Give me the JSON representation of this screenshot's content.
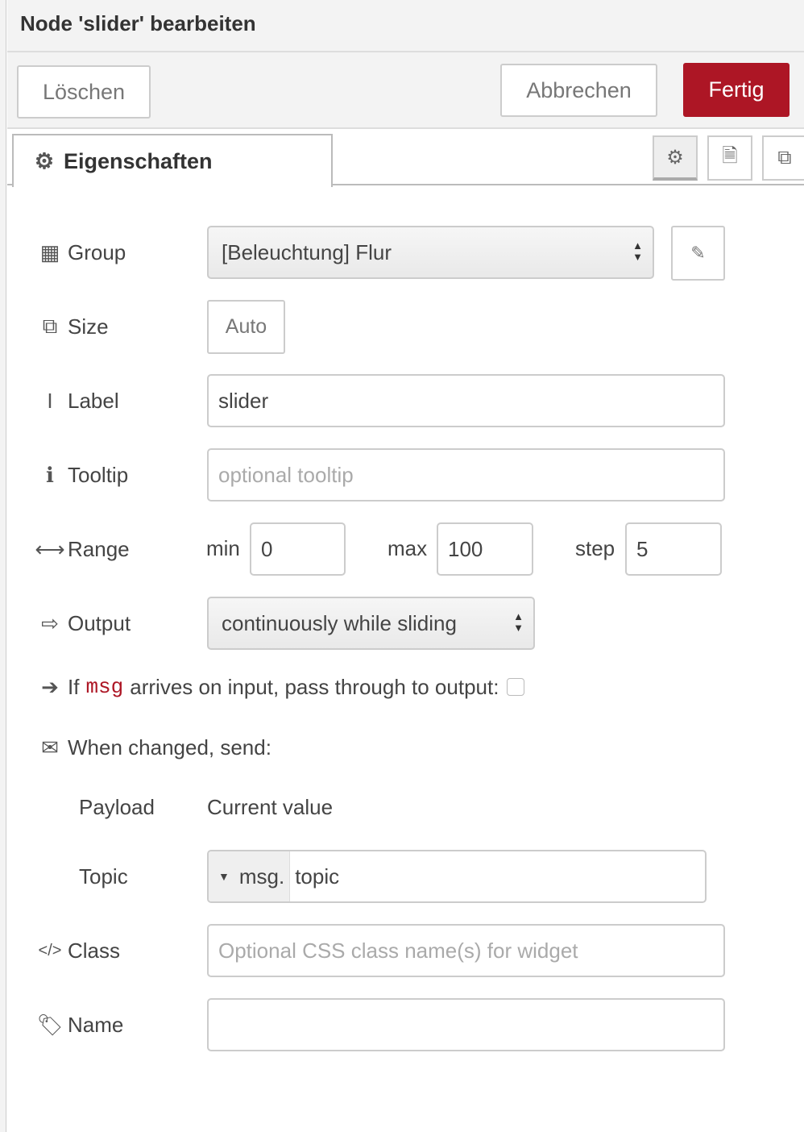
{
  "title": "Node 'slider' bearbeiten",
  "toolbar": {
    "delete": "Löschen",
    "cancel": "Abbrechen",
    "done": "Fertig",
    "accent": "#ad1625"
  },
  "tabs": {
    "properties": "Eigenschaften",
    "icons": [
      "gear-icon",
      "description-icon",
      "appearance-icon"
    ]
  },
  "form": {
    "group": {
      "label": "Group",
      "value": "[Beleuchtung] Flur"
    },
    "size": {
      "label": "Size",
      "value": "Auto"
    },
    "label": {
      "label": "Label",
      "value": "slider"
    },
    "tooltip": {
      "label": "Tooltip",
      "placeholder": "optional tooltip"
    },
    "range": {
      "label": "Range",
      "min_label": "min",
      "min": "0",
      "max_label": "max",
      "max": "100",
      "step_label": "step",
      "step": "5"
    },
    "output": {
      "label": "Output",
      "value": "continuously while sliding"
    },
    "passthrough": {
      "prefix": "If",
      "code": "msg",
      "suffix": "arrives on input, pass through to output:",
      "checked": false
    },
    "send": {
      "label": "When changed, send:"
    },
    "payload": {
      "label": "Payload",
      "value": "Current value"
    },
    "topic": {
      "label": "Topic",
      "type": "msg.",
      "value": "topic"
    },
    "class": {
      "label": "Class",
      "placeholder": "Optional CSS class name(s) for widget"
    },
    "name": {
      "label": "Name",
      "value": ""
    }
  }
}
